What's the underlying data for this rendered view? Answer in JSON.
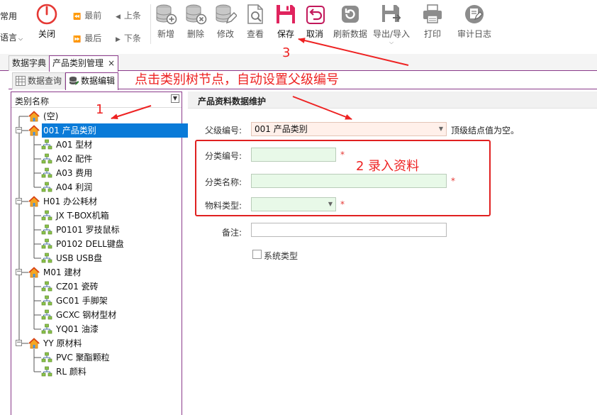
{
  "toolbar": {
    "left_labels": [
      "常用",
      "语言"
    ],
    "close": "关闭",
    "nav": {
      "first": "最前",
      "prev": "上条",
      "last": "最后",
      "next": "下条"
    },
    "buttons": {
      "add": "新增",
      "delete": "删除",
      "edit": "修改",
      "view": "查看",
      "save": "保存",
      "cancel": "取消",
      "refresh": "刷新数据",
      "export": "导出/导入",
      "print": "打印",
      "audit": "审计日志"
    }
  },
  "tabs": [
    "数据字典",
    "产品类别管理"
  ],
  "tab_close_glyph": "×",
  "subtabs": [
    "数据查询",
    "数据编辑"
  ],
  "tree": {
    "header": "类别名称",
    "nodes": [
      {
        "label": "(空)",
        "level": 0,
        "kind": "root"
      },
      {
        "label": "001 产品类别",
        "level": 0,
        "kind": "home",
        "selected": true
      },
      {
        "label": "A01 型材",
        "level": 1,
        "kind": "leaf"
      },
      {
        "label": "A02 配件",
        "level": 1,
        "kind": "leaf"
      },
      {
        "label": "A03 费用",
        "level": 1,
        "kind": "leaf"
      },
      {
        "label": "A04 利润",
        "level": 1,
        "kind": "leaf"
      },
      {
        "label": "H01 办公耗材",
        "level": 0,
        "kind": "home"
      },
      {
        "label": "JX T-BOX机箱",
        "level": 1,
        "kind": "leaf"
      },
      {
        "label": "P0101 罗技鼠标",
        "level": 1,
        "kind": "leaf"
      },
      {
        "label": "P0102 DELL键盘",
        "level": 1,
        "kind": "leaf"
      },
      {
        "label": "USB USB盘",
        "level": 1,
        "kind": "leaf"
      },
      {
        "label": "M01 建材",
        "level": 0,
        "kind": "home"
      },
      {
        "label": "CZ01 瓷砖",
        "level": 1,
        "kind": "leaf"
      },
      {
        "label": "GC01 手脚架",
        "level": 1,
        "kind": "leaf"
      },
      {
        "label": "GCXC 钢材型材",
        "level": 1,
        "kind": "leaf"
      },
      {
        "label": "YQ01 油漆",
        "level": 1,
        "kind": "leaf"
      },
      {
        "label": "YY 原材料",
        "level": 0,
        "kind": "home"
      },
      {
        "label": "PVC 聚酯颗粒",
        "level": 1,
        "kind": "leaf"
      },
      {
        "label": "RL 颜料",
        "level": 1,
        "kind": "leaf"
      }
    ]
  },
  "form": {
    "group_title": "产品资料数据维护",
    "parent_label": "父级编号:",
    "parent_value": "001 产品类别",
    "parent_hint": "顶级结点值为空。",
    "code_label": "分类编号:",
    "code_value": "",
    "name_label": "分类名称:",
    "name_value": "",
    "type_label": "物料类型:",
    "type_value": "",
    "remark_label": "备注:",
    "remark_value": "",
    "system_type_label": "系统类型",
    "required_mark": "*"
  },
  "annotations": {
    "step1": "1",
    "step2": "2 录入资料",
    "step3": "3",
    "instruction": "点击类别树节点，自动设置父级编号"
  },
  "colors": {
    "accent": "#8a3a8a",
    "selected": "#0a7bd8",
    "annotation": "#ee2222",
    "required_fill": "#e8f9e8",
    "parent_fill": "#fff0ea",
    "save_icon": "#e0245e",
    "close_icon": "#e53935"
  }
}
